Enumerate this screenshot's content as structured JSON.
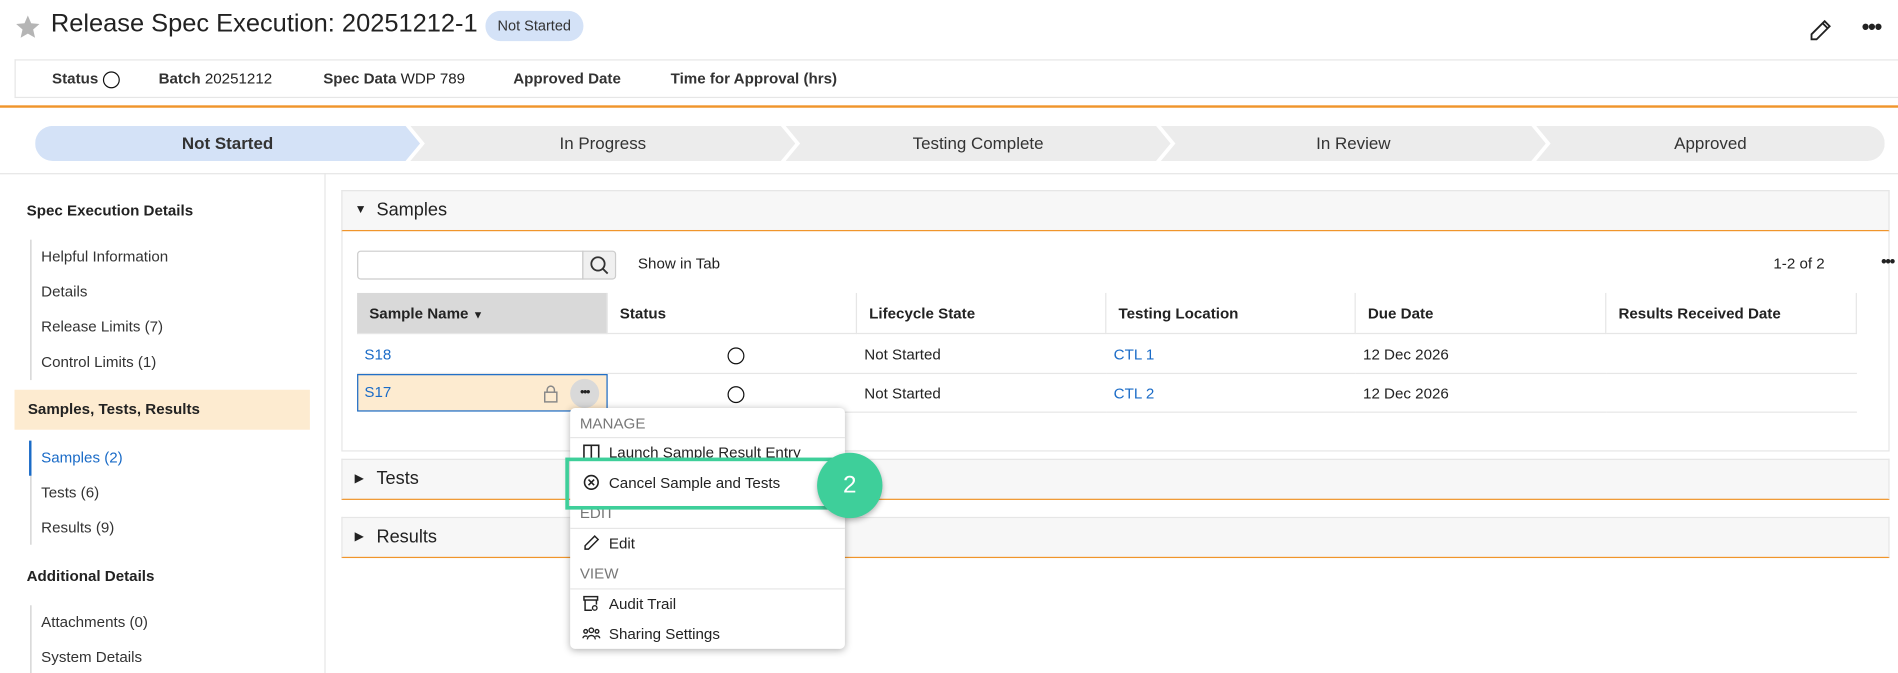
{
  "header": {
    "title": "Release Spec Execution: 20251212-1",
    "status_badge": "Not Started",
    "favorite_icon": "star-icon",
    "edit_icon": "pencil-icon",
    "more_icon": "more-horizontal-icon"
  },
  "info_bar": {
    "status_label": "Status",
    "batch_label": "Batch",
    "batch_value": "20251212",
    "spec_label": "Spec Data",
    "spec_value": "WDP 789",
    "approved_label": "Approved Date",
    "time_label": "Time for Approval (hrs)"
  },
  "lifecycle": {
    "current": "Not Started",
    "stages": [
      "Not Started",
      "In Progress",
      "Testing Complete",
      "In Review",
      "Approved"
    ]
  },
  "sidebar": {
    "section1": "Spec Execution Details",
    "items1": [
      "Helpful Information",
      "Details",
      "Release Limits (7)",
      "Control Limits (1)"
    ],
    "section2": "Samples, Tests, Results",
    "items2": [
      "Samples (2)",
      "Tests (6)",
      "Results (9)"
    ],
    "section3": "Additional Details",
    "items3": [
      "Attachments (0)",
      "System Details"
    ]
  },
  "samples": {
    "title": "Samples",
    "search_placeholder": "",
    "show_in_tab": "Show in Tab",
    "pagination": "1-2 of 2",
    "columns": [
      "Sample Name",
      "Status",
      "Lifecycle State",
      "Testing Location",
      "Due Date",
      "Results Received Date"
    ],
    "rows": [
      {
        "name": "S18",
        "status": "not-started-circle",
        "lifecycle": "Not Started",
        "location": "CTL 1",
        "due": "12 Dec 2026",
        "received": ""
      },
      {
        "name": "S17",
        "status": "not-started-circle",
        "lifecycle": "Not Started",
        "location": "CTL 2",
        "due": "12 Dec 2026",
        "received": ""
      }
    ]
  },
  "sections": {
    "tests": "Tests",
    "results": "Results"
  },
  "context_menu": {
    "manage": "MANAGE",
    "launch": "Launch Sample Result Entry",
    "cancel": "Cancel Sample and Tests",
    "edit_header": "EDIT",
    "edit": "Edit",
    "view": "VIEW",
    "audit": "Audit Trail",
    "sharing": "Sharing Settings"
  },
  "callout": {
    "number": "2",
    "color": "#3ecf9a"
  },
  "colors": {
    "accent_orange": "#f0952b",
    "link_blue": "#1a6bc7",
    "badge_blue": "#d4e2f7",
    "highlight": "#fdebd0"
  }
}
